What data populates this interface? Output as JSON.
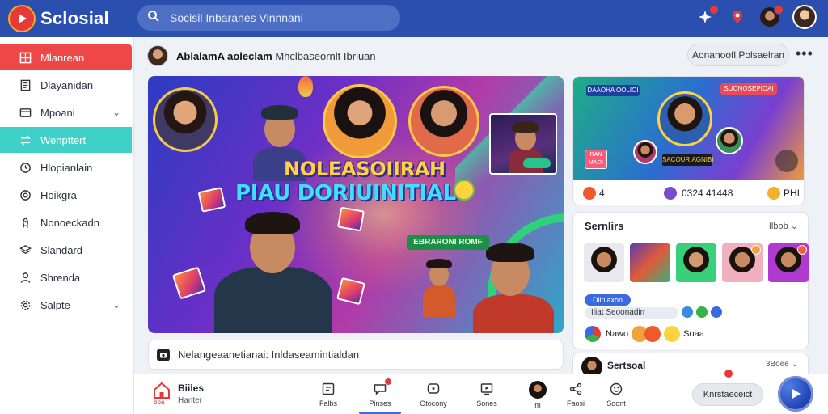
{
  "app": {
    "name": "Sclosial",
    "accent": "#2a4fae"
  },
  "search": {
    "placeholder": "Socisil Inbaranes Vinnnani"
  },
  "sidebar": {
    "items": [
      {
        "label": "Mlanrean",
        "icon": "grid-icon",
        "state": "active-red"
      },
      {
        "label": "Dlayanidan",
        "icon": "document-icon"
      },
      {
        "label": "Mpoani",
        "icon": "card-icon",
        "has_chevron": true
      },
      {
        "label": "Wenpttert",
        "icon": "swap-icon",
        "state": "active-teal"
      },
      {
        "label": "Hlopianlain",
        "icon": "clock-icon"
      },
      {
        "label": "Hoikgra",
        "icon": "target-icon"
      },
      {
        "label": "Nonoeckadn",
        "icon": "rocket-icon"
      },
      {
        "label": "Slandard",
        "icon": "layers-icon"
      },
      {
        "label": "Shrenda",
        "icon": "person-icon"
      },
      {
        "label": "Salpte",
        "icon": "gear-icon",
        "has_chevron": true
      }
    ]
  },
  "post": {
    "author": "AblalamA aoleclam",
    "author_suffix": "Mhclbaseornlt Ibriuan",
    "follow_label": "Aonanoofl Polsaelran",
    "more": "•••",
    "hero_title_line1": "NOLEASOIIRAH",
    "hero_title_line2": "PIAU DORIUINITIAL",
    "hero_subtag": "EBRARONI ROMF",
    "comment_placeholder": "Nelangeaanetianai: Inldaseamintialdan"
  },
  "feature_card": {
    "tag_left": "DAAOHA OOLIOI",
    "tag_right": "SUONOSEPIOAI",
    "strip_text": "SACOURIAGNIBI",
    "pink_text": "RAN MAOI",
    "stat1": "4",
    "stat2": "0324 41448",
    "stat3": "PHI"
  },
  "suggest_card": {
    "title": "Sernlirs",
    "link": "Ilbob ⌄",
    "chip": "Dliniaxon",
    "pill": "Iliat Seoonadirr",
    "react_label_1": "Nawo",
    "react_label_2": "Soaa"
  },
  "second_card": {
    "title": "Sertsoal",
    "link": "3Boee ⌄"
  },
  "bottom": {
    "home_label": "boa",
    "user_name": "Biiles",
    "user_sub": "Hanter",
    "tabs": [
      {
        "label": "Falbs",
        "icon": "note-icon"
      },
      {
        "label": "Pinses",
        "icon": "chat-icon",
        "badge": true
      },
      {
        "label": "Otocony",
        "icon": "bubble-icon"
      },
      {
        "label": "Sones",
        "icon": "monitor-icon"
      },
      {
        "label": "m",
        "icon": "avatar"
      },
      {
        "label": "Faosi",
        "icon": "share-icon"
      },
      {
        "label": "Soont",
        "icon": "smile-icon"
      }
    ],
    "action_label": "Knrstaeceict"
  }
}
